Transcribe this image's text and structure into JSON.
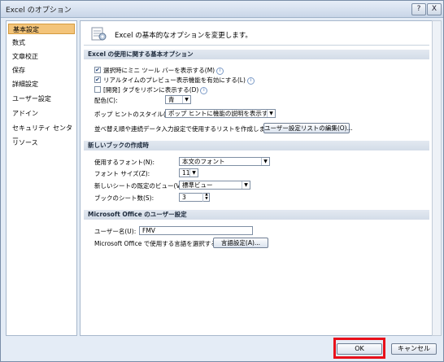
{
  "window": {
    "title": "Excel のオプション",
    "help_label": "?",
    "close_label": "X"
  },
  "sidebar": {
    "items": [
      {
        "label": "基本設定",
        "selected": true
      },
      {
        "label": "数式"
      },
      {
        "label": "文章校正"
      },
      {
        "label": "保存"
      },
      {
        "label": "詳細設定"
      },
      {
        "label": "ユーザー設定"
      },
      {
        "label": "アドイン"
      },
      {
        "label": "セキュリティ センター"
      },
      {
        "label": "リソース"
      }
    ]
  },
  "header": {
    "text": "Excel の基本的なオプションを変更します。"
  },
  "sections": {
    "top": "Excel の使用に関する基本オプション",
    "new_book": "新しいブックの作成時",
    "user": "Microsoft Office のユーザー設定"
  },
  "top_options": {
    "mini_toolbar": {
      "label": "選択時にミニ ツール バーを表示する(M)",
      "checked": true
    },
    "live_preview": {
      "label": "リアルタイムのプレビュー表示機能を有効にする(L)",
      "checked": true
    },
    "developer_tab": {
      "label": "[開発] タブをリボンに表示する(D)",
      "checked": false
    },
    "color_label": "配色(C):",
    "color_value": "青",
    "tooltip_label": "ポップ ヒントのスタイル(R):",
    "tooltip_value": "ポップ ヒントに機能の説明を表示する",
    "sort_list_label": "並べ替え順や連続データ入力設定で使用するリストを作成します:",
    "sort_list_button": "ユーザー設定リストの編集(O)..."
  },
  "new_book": {
    "font_label": "使用するフォント(N):",
    "font_value": "本文のフォント",
    "size_label": "フォント サイズ(Z):",
    "size_value": "11",
    "view_label": "新しいシートの既定のビュー(V):",
    "view_value": "標準ビュー",
    "sheets_label": "ブックのシート数(S):",
    "sheets_value": "3"
  },
  "user": {
    "username_label": "ユーザー名(U):",
    "username_value": "FMV",
    "language_label": "Microsoft Office で使用する言語を選択する:",
    "language_button": "言語設定(A)..."
  },
  "footer": {
    "ok_label": "OK",
    "cancel_label": "キャンセル"
  },
  "icons": {
    "arrow": "▼",
    "spin_up": "▲",
    "spin_down": "▼",
    "info": "i",
    "check": "✔"
  },
  "colors": {
    "highlight": "#e8101a",
    "selected": "#f3c47a"
  }
}
